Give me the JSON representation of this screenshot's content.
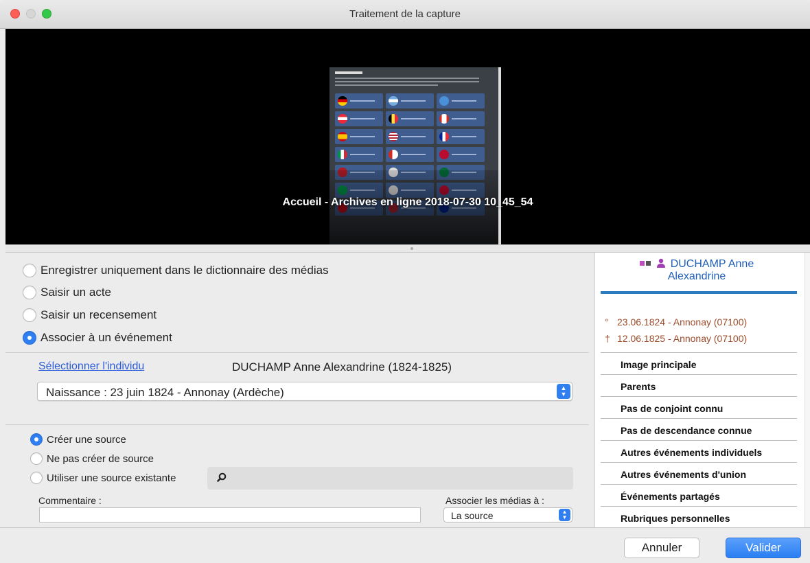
{
  "window": {
    "title": "Traitement de la capture"
  },
  "preview": {
    "caption": "Accueil - Archives en ligne 2018-07-30 10_45_54"
  },
  "options": {
    "save_only": "Enregistrer uniquement dans le dictionnaire des médias",
    "enter_act": "Saisir un acte",
    "enter_census": "Saisir un recensement",
    "associate_event": "Associer à un événement",
    "selected": "associate_event"
  },
  "event": {
    "select_individual_link": "Sélectionner l'individu",
    "individual": "DUCHAMP Anne Alexandrine (1824-1825)",
    "event_value": "Naissance : 23 juin 1824 - Annonay (Ardèche)"
  },
  "source": {
    "create": "Créer une source",
    "none": "Ne pas créer de source",
    "existing": "Utiliser une source existante",
    "selected": "create"
  },
  "comment": {
    "label": "Commentaire :",
    "value": ""
  },
  "assoc_media": {
    "label": "Associer les médias à :",
    "value": "La source"
  },
  "person": {
    "name_line1": "DUCHAMP Anne",
    "name_line2": "Alexandrine",
    "birth_symbol": "°",
    "birth": "23.06.1824 - Annonay (07100)",
    "death_symbol": "†",
    "death": "12.06.1825 - Annonay (07100)"
  },
  "sidebar_items": [
    "Image principale",
    "Parents",
    "Pas de conjoint connu",
    "Pas de descendance connue",
    "Autres événements individuels",
    "Autres événements d'union",
    "Événements partagés",
    "Rubriques personnelles"
  ],
  "buttons": {
    "cancel": "Annuler",
    "ok": "Valider"
  },
  "colors": {
    "accent": "#2f7ff0",
    "link": "#2a5bd7",
    "person_name": "#1f5fb7",
    "life_dates": "#9b4b2a",
    "bar": "#2a7bbf"
  }
}
